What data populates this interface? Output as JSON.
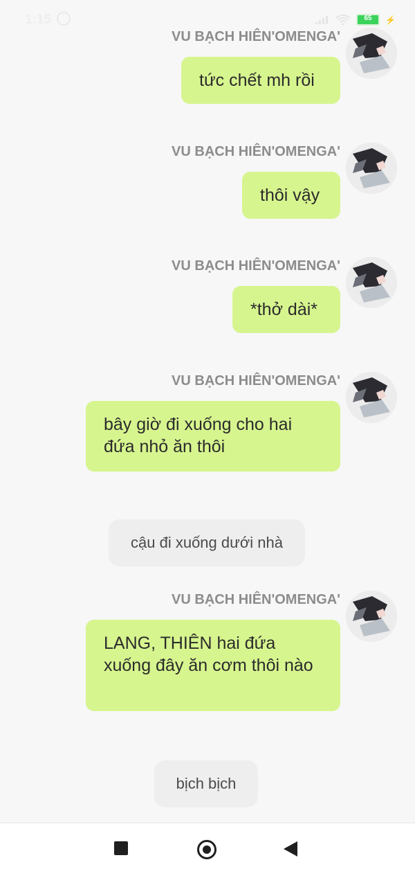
{
  "status_bar": {
    "time": "1:15",
    "battery": "65"
  },
  "messages": [
    {
      "sender": "VU BẠCH HIÊN'OMENGA'",
      "text": "tức chết mh rồi"
    },
    {
      "sender": "VU BẠCH HIÊN'OMENGA'",
      "text": "thôi vậy"
    },
    {
      "sender": "VU BẠCH HIÊN'OMENGA'",
      "text": "*thở dài*"
    },
    {
      "sender": "VU BẠCH HIÊN'OMENGA'",
      "text": "bây giờ đi xuống cho hai đứa nhỏ ăn thôi"
    },
    {
      "system": "cậu đi xuống dưới nhà"
    },
    {
      "sender": "VU BẠCH HIÊN'OMENGA'",
      "text": "LANG, THIÊN hai đứa xuống đây ăn cơm thôi nào"
    },
    {
      "system": "bịch bịch"
    }
  ],
  "colors": {
    "bubble": "#d7f58f",
    "system_bubble": "#eeeeee",
    "background": "#f7f7f7"
  },
  "icons": {
    "nav_left": "square-stop-icon",
    "nav_center": "home-circle-icon",
    "nav_right": "back-triangle-icon"
  }
}
